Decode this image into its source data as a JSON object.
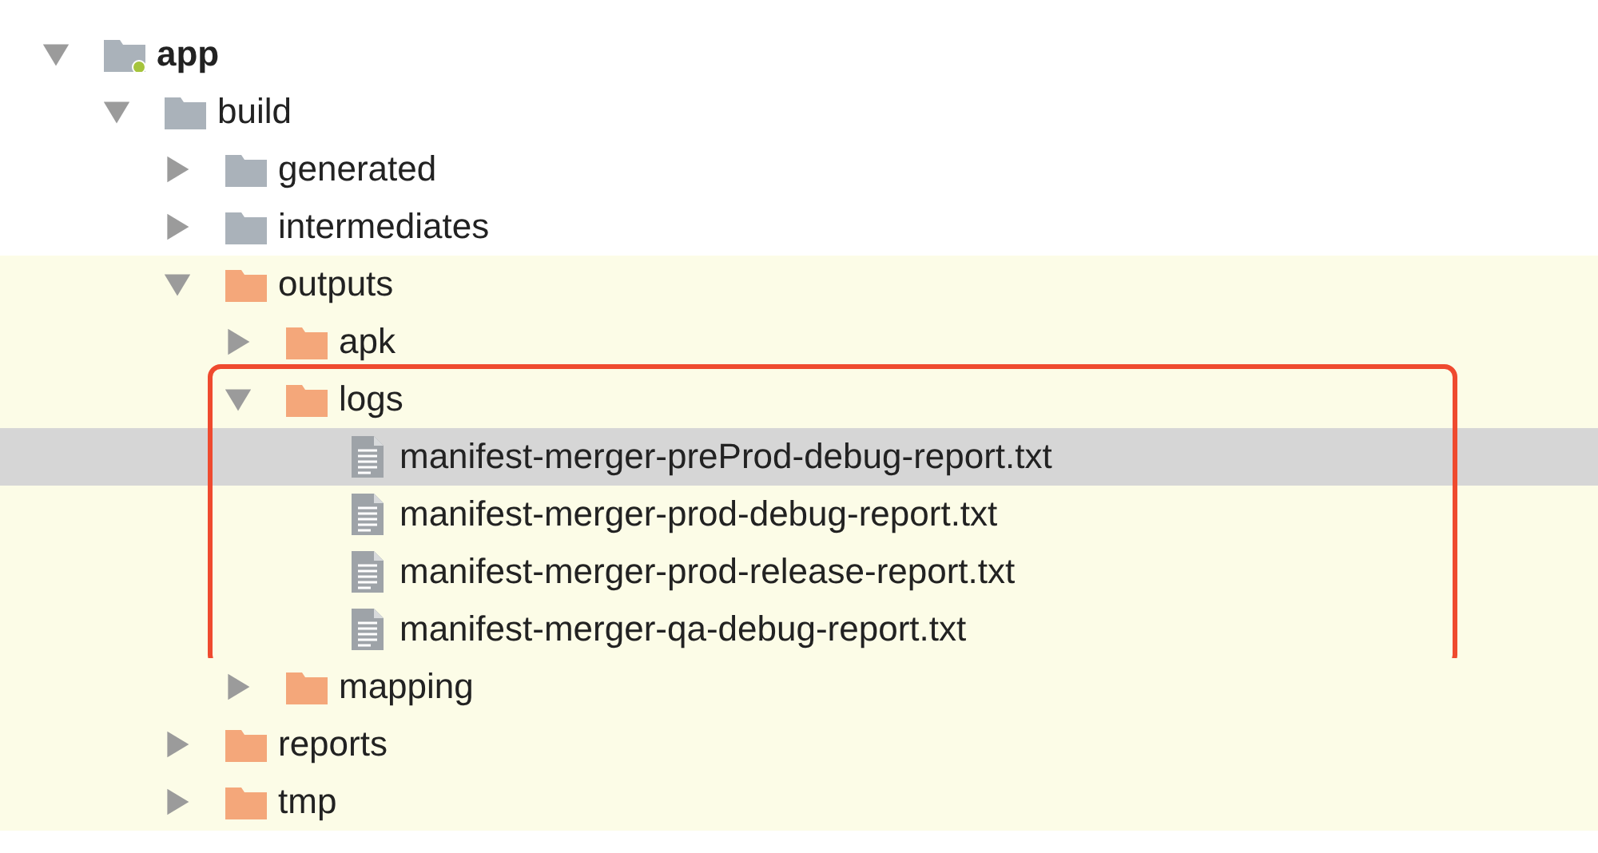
{
  "tree": [
    {
      "label": "app",
      "kind": "module",
      "expanded": true,
      "excluded": false,
      "selected": false,
      "children": [
        {
          "label": "build",
          "kind": "folder",
          "expanded": true,
          "excluded": false,
          "selected": false,
          "children": [
            {
              "label": "generated",
              "kind": "folder",
              "expanded": false,
              "excluded": false,
              "selected": false
            },
            {
              "label": "intermediates",
              "kind": "folder",
              "expanded": false,
              "excluded": false,
              "selected": false
            },
            {
              "label": "outputs",
              "kind": "folder",
              "expanded": true,
              "excluded": true,
              "selected": false,
              "children": [
                {
                  "label": "apk",
                  "kind": "folder",
                  "expanded": false,
                  "excluded": true,
                  "selected": false
                },
                {
                  "label": "logs",
                  "kind": "folder",
                  "expanded": true,
                  "excluded": true,
                  "selected": false,
                  "highlighted": true,
                  "children": [
                    {
                      "label": "manifest-merger-preProd-debug-report.txt",
                      "kind": "file",
                      "excluded": true,
                      "selected": true
                    },
                    {
                      "label": "manifest-merger-prod-debug-report.txt",
                      "kind": "file",
                      "excluded": true,
                      "selected": false
                    },
                    {
                      "label": "manifest-merger-prod-release-report.txt",
                      "kind": "file",
                      "excluded": true,
                      "selected": false
                    },
                    {
                      "label": "manifest-merger-qa-debug-report.txt",
                      "kind": "file",
                      "excluded": true,
                      "selected": false
                    }
                  ]
                },
                {
                  "label": "mapping",
                  "kind": "folder",
                  "expanded": false,
                  "excluded": true,
                  "selected": false
                }
              ]
            },
            {
              "label": "reports",
              "kind": "folder",
              "expanded": false,
              "excluded": true,
              "selected": false
            },
            {
              "label": "tmp",
              "kind": "folder",
              "expanded": false,
              "excluded": true,
              "selected": false
            }
          ]
        }
      ]
    }
  ]
}
